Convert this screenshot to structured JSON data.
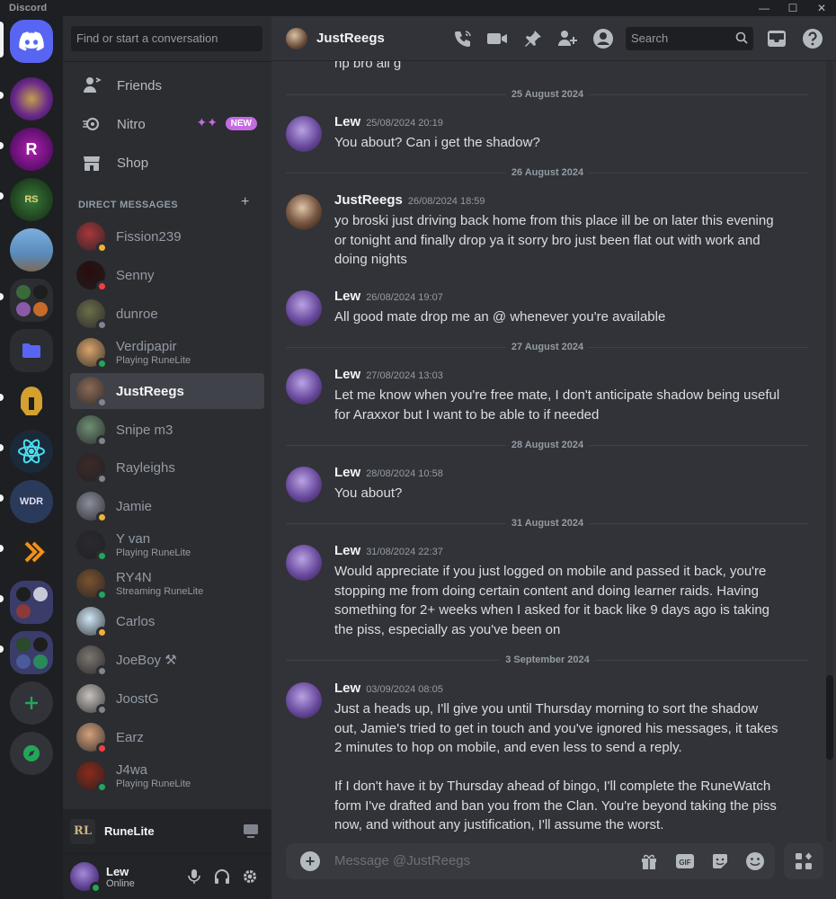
{
  "window": {
    "app_name": "Discord",
    "controls": [
      "—",
      "☐",
      "✕"
    ]
  },
  "dm_column": {
    "search_placeholder": "Find or start a conversation",
    "nav": [
      {
        "label": "Friends",
        "icon": "friends-icon"
      },
      {
        "label": "Nitro",
        "icon": "nitro-icon",
        "badge": "NEW"
      },
      {
        "label": "Shop",
        "icon": "shop-icon"
      }
    ],
    "dm_header": "DIRECT MESSAGES",
    "dm_add": "+",
    "dms": [
      {
        "name": "Fission239",
        "status": "idle",
        "sub": "",
        "color": "#a7373a"
      },
      {
        "name": "Senny",
        "status": "dnd",
        "sub": "",
        "color": "#2a0d0d"
      },
      {
        "name": "dunroe",
        "status": "offline",
        "sub": "",
        "color": "#6b6e4a"
      },
      {
        "name": "Verdipapir",
        "status": "online",
        "sub": "Playing RuneLite",
        "color": "#d9a46b"
      },
      {
        "name": "JustReegs",
        "status": "offline",
        "sub": "",
        "color": "#8a6a55",
        "active": true
      },
      {
        "name": "Snipe m3",
        "status": "offline",
        "sub": "",
        "color": "#6f8e74"
      },
      {
        "name": "Rayleighs",
        "status": "offline",
        "sub": "",
        "color": "#3d2a2a"
      },
      {
        "name": "Jamie",
        "status": "idle",
        "sub": "",
        "color": "#8b8f9a"
      },
      {
        "name": "Y van",
        "status": "online",
        "sub": "Playing RuneLite",
        "color": "#2a2a30"
      },
      {
        "name": "RY4N",
        "status": "online",
        "sub": "Streaming RuneLite",
        "color": "#7a5230"
      },
      {
        "name": "Carlos",
        "status": "idle",
        "sub": "",
        "color": "#cfe6f5"
      },
      {
        "name": "JoeBoy ⚒",
        "status": "offline",
        "sub": "",
        "color": "#7a7570"
      },
      {
        "name": "JoostG",
        "status": "offline",
        "sub": "",
        "color": "#c8c2bd"
      },
      {
        "name": "Earz",
        "status": "dnd",
        "sub": "",
        "color": "#d4a07a"
      },
      {
        "name": "J4wa",
        "status": "online",
        "sub": "Playing RuneLite",
        "color": "#8a2a1a"
      }
    ],
    "runelite_bar": {
      "logo": "RL",
      "label": "RuneLite"
    },
    "user": {
      "name": "Lew",
      "status": "Online"
    }
  },
  "chat": {
    "recipient": "JustReegs",
    "search_placeholder": "Search",
    "partial_line": "np bro all g",
    "composer_placeholder": "Message @JustReegs",
    "separators": [
      "25 August 2024",
      "26 August 2024",
      "27 August 2024",
      "28 August 2024",
      "31 August 2024",
      "3 September 2024"
    ],
    "messages": [
      {
        "author": "Lew",
        "time": "25/08/2024 20:19",
        "lines": [
          "You about? Can i get the shadow?"
        ]
      },
      {
        "author": "JustReegs",
        "time": "26/08/2024 18:59",
        "lines": [
          "yo broski just driving back home from this place ill be on later this evening",
          "or tonight and finally drop ya it sorry bro just been flat out with work and",
          "doing nights"
        ]
      },
      {
        "author": "Lew",
        "time": "26/08/2024 19:07",
        "lines": [
          "All good mate drop me an @ whenever you're available"
        ]
      },
      {
        "author": "Lew",
        "time": "27/08/2024 13:03",
        "lines": [
          "Let me know when you're free mate, I don't anticipate shadow being useful",
          "for Araxxor but I want to be able to if needed"
        ]
      },
      {
        "author": "Lew",
        "time": "28/08/2024 10:58",
        "lines": [
          "You about?"
        ]
      },
      {
        "author": "Lew",
        "time": "31/08/2024 22:37",
        "lines": [
          "Would appreciate if you just logged on mobile and passed it back, you're",
          "stopping me from doing certain content and doing learner raids. Having",
          "something for 2+ weeks when I asked for it back like 9 days ago is taking",
          "the piss, especially as you've been on"
        ]
      },
      {
        "author": "Lew",
        "time": "03/09/2024 08:05",
        "lines": [
          "Just a heads up, I'll give you until Thursday morning to sort the shadow",
          "out, Jamie's tried to get in touch and you've ignored his messages, it takes",
          "2 minutes to hop on mobile, and even less to send a reply.",
          "",
          "If I don't have it by Thursday ahead of bingo, I'll complete the RuneWatch",
          "form I've drafted and ban you from the Clan. You're beyond taking the piss",
          "now, and without any justification, I'll assume the worst."
        ]
      }
    ]
  },
  "colors": {
    "accent": "#5865f2",
    "online": "#23a55a",
    "idle": "#f0b232",
    "dnd": "#f23f43",
    "offline": "#80848e",
    "nitro": "#c46be0"
  }
}
